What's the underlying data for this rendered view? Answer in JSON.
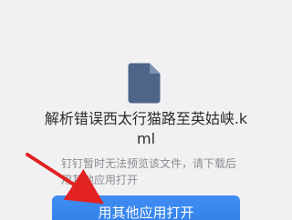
{
  "file": {
    "name": "解析错误西太行猫路至英姑峡.kml",
    "icon": "document-icon"
  },
  "message": {
    "preview_unavailable": "钉钉暂时无法预览该文件，请下载后用其他应用打开"
  },
  "actions": {
    "open_with_other_app": "用其他应用打开"
  },
  "colors": {
    "background": "#f1f1f3",
    "primary_button": "#3387ee",
    "file_icon": "#4e6489",
    "annotation_arrow": "#e22121"
  }
}
